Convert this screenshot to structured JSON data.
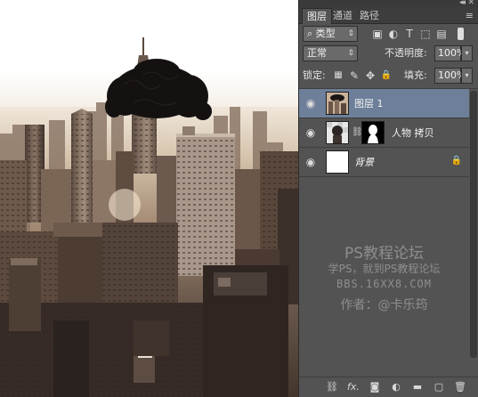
{
  "panel": {
    "tabs": [
      "图层",
      "通道",
      "路径"
    ],
    "active_tab": 0,
    "filter_kind": "类型",
    "blend_mode": "正常",
    "opacity_label": "不透明度:",
    "opacity_value": "100%",
    "lock_label": "锁定:",
    "fill_label": "填充:",
    "fill_value": "100%",
    "layers": [
      {
        "name": "图层 1",
        "selected": true,
        "visible": true
      },
      {
        "name": "人物 拷贝",
        "selected": false,
        "visible": true,
        "has_mask": true
      },
      {
        "name": "背景",
        "selected": false,
        "visible": true,
        "locked": true
      }
    ],
    "watermark": {
      "line1": "PS教程论坛",
      "line2": "学PS，就到PS教程论坛",
      "line3": "BBS.16XX8.COM",
      "line4": "作者：@卡乐筠"
    }
  },
  "colors": {
    "panel_bg": "#535353",
    "selected_layer": "#6d7f99",
    "tab_bar": "#3d3d3d"
  }
}
